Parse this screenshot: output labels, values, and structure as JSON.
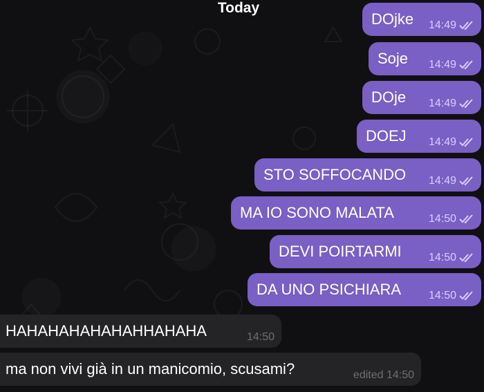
{
  "header": {
    "date_label": "Today"
  },
  "messages": [
    {
      "text": "DOjke",
      "time": "14:49",
      "direction": "outgoing",
      "status_icon": "double-check-icon"
    },
    {
      "text": "Soje",
      "time": "14:49",
      "direction": "outgoing",
      "status_icon": "double-check-icon"
    },
    {
      "text": "DOje",
      "time": "14:49",
      "direction": "outgoing",
      "status_icon": "double-check-icon"
    },
    {
      "text": "DOEJ",
      "time": "14:49",
      "direction": "outgoing",
      "status_icon": "double-check-icon"
    },
    {
      "text": "STO SOFFOCANDO",
      "time": "14:49",
      "direction": "outgoing",
      "status_icon": "double-check-icon"
    },
    {
      "text": "MA IO SONO MALATA",
      "time": "14:50",
      "direction": "outgoing",
      "status_icon": "double-check-icon"
    },
    {
      "text": "DEVI POIRTARMI",
      "time": "14:50",
      "direction": "outgoing",
      "status_icon": "double-check-icon"
    },
    {
      "text": "DA UNO PSICHIARA",
      "time": "14:50",
      "direction": "outgoing",
      "status_icon": "double-check-icon"
    },
    {
      "text": "HAHAHAHAHAHAHHAHAHA",
      "time": "14:50",
      "direction": "incoming"
    },
    {
      "text": "ma non vivi già in un manicomio, scusami?",
      "time": "edited 14:50",
      "direction": "incoming"
    }
  ],
  "colors": {
    "outgoing_bubble": "#7a5fc4",
    "incoming_bubble": "#242426",
    "background": "#101012"
  }
}
